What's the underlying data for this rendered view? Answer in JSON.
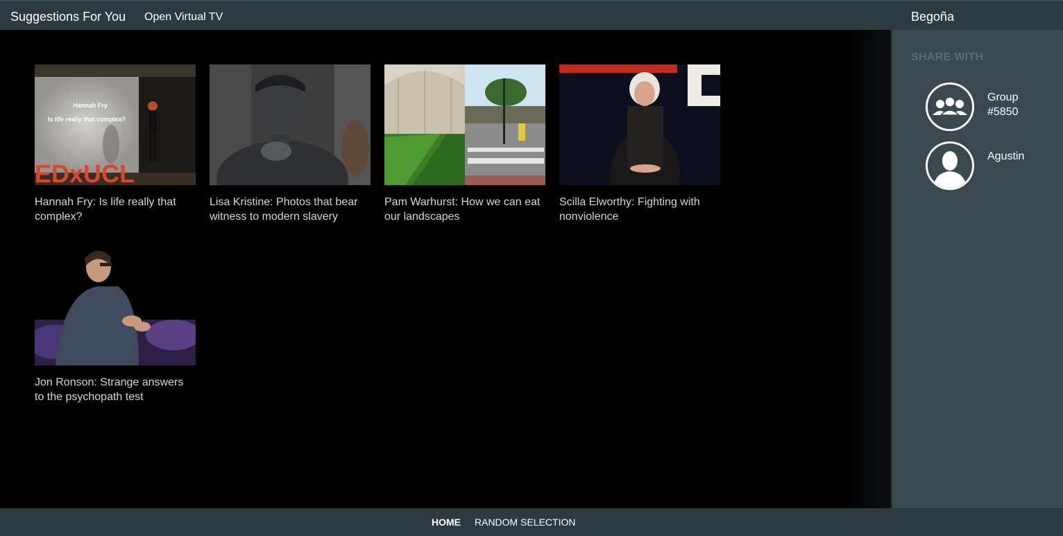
{
  "header": {
    "title": "Suggestions For You",
    "virtual_tv": "Open Virtual TV",
    "user": "Begoña"
  },
  "videos": [
    {
      "title": "Hannah Fry: Is life really that complex?",
      "slide_name": "Hannah Fry",
      "slide_text": "Is life really that complex?",
      "logo": "EDxUCL"
    },
    {
      "title": "Lisa Kristine: Photos that bear witness to modern slavery"
    },
    {
      "title": "Pam Warhurst: How we can eat our landscapes"
    },
    {
      "title": "Scilla Elworthy: Fighting with nonviolence"
    },
    {
      "title": "Jon Ronson: Strange answers to the psychopath test"
    }
  ],
  "share": {
    "title": "SHARE WITH",
    "contacts": [
      {
        "name": "Group #5850",
        "icon": "group-icon"
      },
      {
        "name": "Agustin",
        "icon": "user-icon"
      }
    ]
  },
  "footer": {
    "home": "HOME",
    "random": "RANDOM SELECTION"
  }
}
